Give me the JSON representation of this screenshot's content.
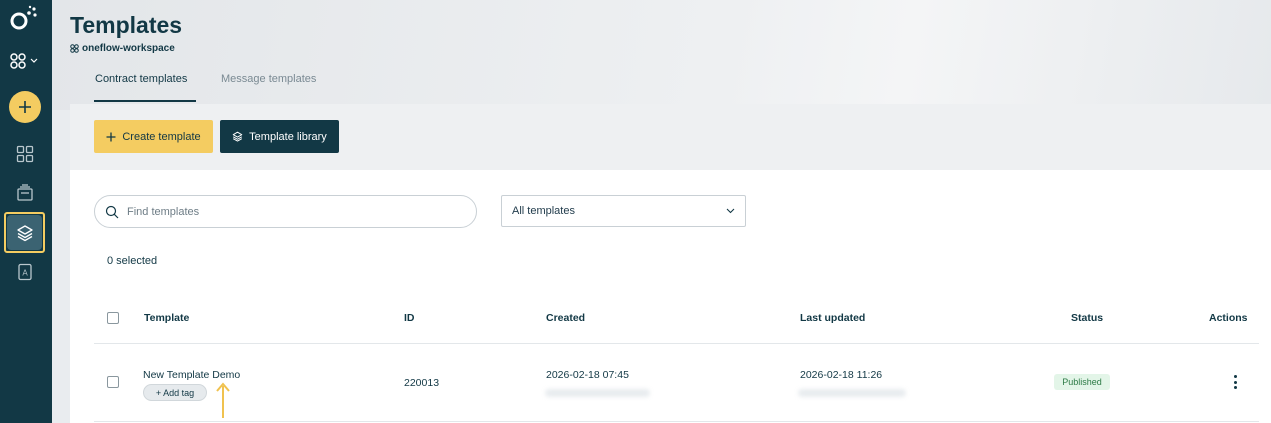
{
  "header": {
    "title": "Templates",
    "workspace": "oneflow-workspace"
  },
  "tabs": [
    {
      "label": "Contract templates",
      "active": true
    },
    {
      "label": "Message templates",
      "active": false
    }
  ],
  "toolbar": {
    "create_label": "Create template",
    "library_label": "Template library"
  },
  "filters": {
    "search_placeholder": "Find templates",
    "search_value": "",
    "type_selected": "All templates"
  },
  "selection": {
    "count_text": "0 selected"
  },
  "table": {
    "columns": [
      "Template",
      "ID",
      "Created",
      "Last updated",
      "Status",
      "Actions"
    ],
    "rows": [
      {
        "name": "New Template Demo",
        "tag_button": "+ Add tag",
        "id": "220013",
        "created": "2026-02-18 07:45",
        "updated": "2026-02-18 11:26",
        "status": "Published"
      }
    ]
  },
  "sidebar": {
    "items": [
      {
        "icon": "logo-icon"
      },
      {
        "icon": "workspace-switch-icon"
      },
      {
        "icon": "plus-icon"
      },
      {
        "icon": "dashboard-grid-icon"
      },
      {
        "icon": "documents-icon"
      },
      {
        "icon": "templates-layers-icon",
        "active": true
      },
      {
        "icon": "address-book-icon"
      }
    ]
  },
  "colors": {
    "sidebar": "#123845",
    "accent_yellow": "#f4cc61",
    "primary_dark": "#123845",
    "published_bg": "#e3f5e8",
    "published_text": "#2c7a45"
  }
}
